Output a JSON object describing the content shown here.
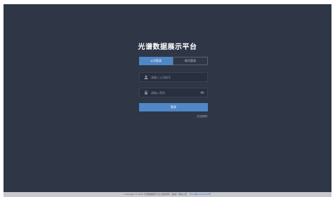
{
  "page": {
    "title": "光谱数据展示平台"
  },
  "tabs": [
    {
      "label": "公司登录",
      "active": true
    },
    {
      "label": "账号登录",
      "active": false
    }
  ],
  "form": {
    "username_placeholder": "请输入公司账号",
    "password_placeholder": "请输入密码",
    "login_label": "登录",
    "forgot_label": "忘记密码?"
  },
  "footer": {
    "copyright": "Copyright © 2023 光谱数据展示平台 版权所有（备案）网站公安：",
    "icp": "京ICP备XXXXXXXX号"
  },
  "colors": {
    "background": "#2f3646",
    "accent": "#4f87c7",
    "footer": "#c7c9cc"
  },
  "icons": {
    "username": "user-icon",
    "password": "lock-icon",
    "visibility": "eye-icon"
  }
}
